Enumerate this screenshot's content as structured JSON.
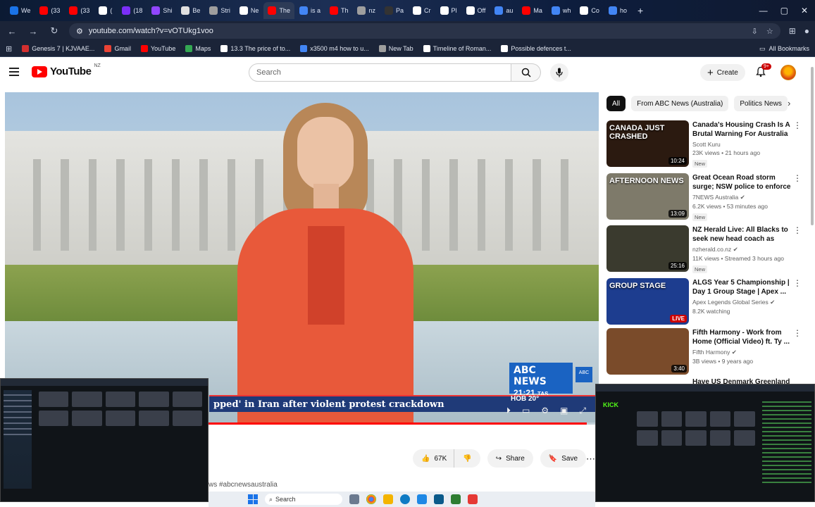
{
  "browser": {
    "tabs": [
      {
        "label": "We",
        "color": "#1a73e8"
      },
      {
        "label": "(33",
        "color": "#ff0000"
      },
      {
        "label": "(33",
        "color": "#ff0000"
      },
      {
        "label": "(",
        "color": "#ffffff"
      },
      {
        "label": "(18",
        "color": "#7b2ff7"
      },
      {
        "label": "Shi",
        "color": "#9146ff"
      },
      {
        "label": "Be",
        "color": "#e0e0e0"
      },
      {
        "label": "Stri",
        "color": "#9e9e9e"
      },
      {
        "label": "Ne",
        "color": "#ffffff"
      },
      {
        "label": "The",
        "color": "#ff0000",
        "active": true
      },
      {
        "label": "is a",
        "color": "#4285f4"
      },
      {
        "label": "Th",
        "color": "#ff0000"
      },
      {
        "label": "nz",
        "color": "#9e9e9e"
      },
      {
        "label": "Pa",
        "color": "#333333"
      },
      {
        "label": "Cr",
        "color": "#ffffff"
      },
      {
        "label": "Pl",
        "color": "#ffffff"
      },
      {
        "label": "Off",
        "color": "#ffffff"
      },
      {
        "label": "au",
        "color": "#4285f4"
      },
      {
        "label": "Ma",
        "color": "#ff0000"
      },
      {
        "label": "wh",
        "color": "#4285f4"
      },
      {
        "label": "Co",
        "color": "#ffffff"
      },
      {
        "label": "ho",
        "color": "#4285f4"
      }
    ],
    "new_tab": "+",
    "url": "youtube.com/watch?v=vOTUkg1voo",
    "bookmarks": [
      {
        "label": "Genesis 7 | KJVAAE...",
        "color": "#d32f2f"
      },
      {
        "label": "Gmail",
        "color": "#ea4335"
      },
      {
        "label": "YouTube",
        "color": "#ff0000"
      },
      {
        "label": "Maps",
        "color": "#34a853"
      },
      {
        "label": "13.3 The price of to...",
        "color": "#ffffff"
      },
      {
        "label": "x3500 m4 how to u...",
        "color": "#4285f4"
      },
      {
        "label": "New Tab",
        "color": "#9e9e9e"
      },
      {
        "label": "Timeline of Roman...",
        "color": "#ffffff"
      },
      {
        "label": "Possible defences t...",
        "color": "#ffffff"
      }
    ],
    "all_bookmarks": "All Bookmarks"
  },
  "youtube": {
    "logo_text": "YouTube",
    "country": "NZ",
    "search_placeholder": "Search",
    "create_label": "Create",
    "notif_count": "9+",
    "chips": [
      "All",
      "From ABC News (Australia)",
      "Politics News"
    ],
    "video": {
      "ticker": "pped' in Iran after violent protest crackdown",
      "abc_brand": "ABC NEWS",
      "abc_time": "21:21",
      "abc_tz": "TAS",
      "weather": "HOB  20°",
      "progress": 0.98
    },
    "actions": {
      "likes": "67K",
      "share": "Share",
      "save": "Save"
    },
    "hashtags": "ws #abcnewsaustralia",
    "recommendations": [
      {
        "title": "Canada's Housing Crash Is A Brutal Warning For Australia ...",
        "channel": "Scott Kuru",
        "meta": "23K views • 21 hours ago",
        "badge": "New",
        "duration": "10:24",
        "caption": "CANADA JUST CRASHED",
        "verified": false,
        "thumb_color": "#2b1a10"
      },
      {
        "title": "Great Ocean Road storm surge; NSW police to enforce protest ...",
        "channel": "7NEWS Australia",
        "meta": "6.2K views • 53 minutes ago",
        "badge": "New",
        "duration": "13:09",
        "caption": "AFTERNOON NEWS",
        "verified": true,
        "thumb_color": "#7e7a6a"
      },
      {
        "title": "NZ Herald Live: All Blacks to seek new head coach as Scott...",
        "channel": "nzherald.co.nz",
        "meta": "11K views • Streamed 3 hours ago",
        "badge": "New",
        "duration": "25:16",
        "caption": "",
        "verified": true,
        "thumb_color": "#3a3a2e"
      },
      {
        "title": "ALGS Year 5 Championship | Day 1 Group Stage | Apex ...",
        "channel": "Apex Legends Global Series",
        "meta": "8.2K watching",
        "badge": "",
        "duration": "LIVE",
        "caption": "GROUP STAGE",
        "verified": true,
        "thumb_color": "#1d3d8f"
      },
      {
        "title": "Fifth Harmony - Work from Home (Official Video) ft. Ty ...",
        "channel": "Fifth Harmony",
        "meta": "3B views • 9 years ago",
        "badge": "",
        "duration": "3:40",
        "caption": "",
        "verified": true,
        "thumb_color": "#7a4b2a"
      }
    ],
    "partial_title": "Have US Denmark Greenland"
  },
  "taskbar": {
    "search": "Search"
  }
}
